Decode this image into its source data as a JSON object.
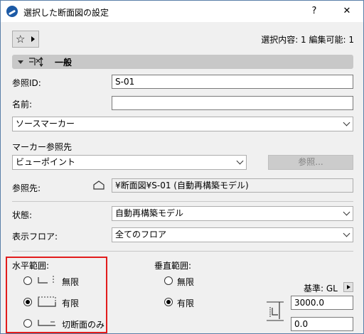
{
  "window": {
    "title": "選択した断面図の設定",
    "help": "?",
    "close": "✕"
  },
  "toolbar": {
    "favorites_icon": "star-icon",
    "selection_info": "選択内容: 1 編集可能: 1"
  },
  "section": {
    "title": "一般"
  },
  "form": {
    "ref_id_label": "参照ID:",
    "ref_id_value": "S-01",
    "name_label": "名前:",
    "name_value": "",
    "marker_type": "ソースマーカー",
    "marker_ref_label": "マーカー参照先",
    "marker_ref_value": "ビューポイント",
    "browse_button": "参照...",
    "ref_target_label": "参照先:",
    "ref_target_value": "¥断面図¥S-01 (自動再構築モデル)",
    "status_label": "状態:",
    "status_value": "自動再構築モデル",
    "floor_label": "表示フロア:",
    "floor_value": "全てのフロア"
  },
  "horizontal": {
    "label": "水平範囲:",
    "options": [
      "無限",
      "有限",
      "切断面のみ"
    ],
    "selected": "有限"
  },
  "vertical": {
    "label": "垂直範囲:",
    "options": [
      "無限",
      "有限"
    ],
    "selected": "有限",
    "base_label": "基準: GL",
    "top_value": "3000.0",
    "bottom_value": "0.0"
  }
}
